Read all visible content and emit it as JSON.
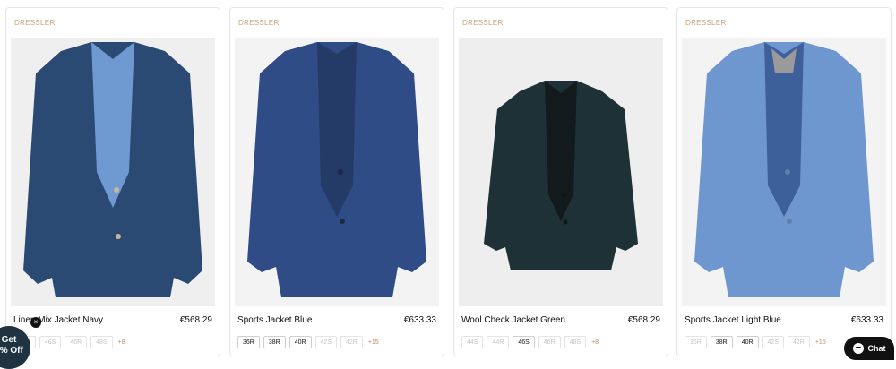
{
  "products": [
    {
      "brand": "DRESSLER",
      "title": "Linen Mix Jacket Navy",
      "price": "€568.29",
      "sizes": [
        {
          "label": "44R",
          "available": false
        },
        {
          "label": "46S",
          "available": false
        },
        {
          "label": "46R",
          "available": false
        },
        {
          "label": "48S",
          "available": false
        }
      ],
      "more": "+8",
      "image": {
        "jacket_color": "#2b4a73",
        "lining_color": "#6f9ad1",
        "bg": "#efefef"
      }
    },
    {
      "brand": "DRESSLER",
      "title": "Sports Jacket Blue",
      "price": "€633.33",
      "sizes": [
        {
          "label": "36R",
          "available": true
        },
        {
          "label": "38R",
          "available": true
        },
        {
          "label": "40R",
          "available": true
        },
        {
          "label": "42S",
          "available": false
        },
        {
          "label": "42R",
          "available": false
        }
      ],
      "more": "+15",
      "image": {
        "jacket_color": "#2f4c86",
        "lining_color": "#243a67",
        "bg": "#f3f3f3"
      }
    },
    {
      "brand": "DRESSLER",
      "title": "Wool Check Jacket Green",
      "price": "€568.29",
      "sizes": [
        {
          "label": "44S",
          "available": false
        },
        {
          "label": "44R",
          "available": false
        },
        {
          "label": "46S",
          "available": true
        },
        {
          "label": "46R",
          "available": false
        },
        {
          "label": "48S",
          "available": false
        }
      ],
      "more": "+8",
      "image": {
        "jacket_color": "#1d3136",
        "lining_color": "#121a1c",
        "bg": "#eeeeee"
      }
    },
    {
      "brand": "DRESSLER",
      "title": "Sports Jacket Light Blue",
      "price": "€633.33",
      "sizes": [
        {
          "label": "36R",
          "available": false
        },
        {
          "label": "38R",
          "available": true
        },
        {
          "label": "40R",
          "available": true
        },
        {
          "label": "42S",
          "available": false
        },
        {
          "label": "42R",
          "available": false
        }
      ],
      "more": "+15",
      "image": {
        "jacket_color": "#6f97cf",
        "lining_color": "#3d5f9a",
        "bg": "#f3f3f3"
      }
    }
  ],
  "promo": {
    "line1": "Get",
    "line2": "0% Off",
    "close": "×"
  },
  "chat": {
    "label": "Chat"
  }
}
